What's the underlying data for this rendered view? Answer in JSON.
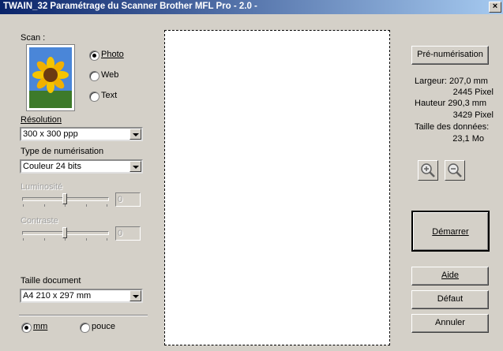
{
  "window": {
    "title": "TWAIN_32 Paramétrage du Scanner Brother MFL Pro - 2.0 -",
    "close_glyph": "×"
  },
  "scan": {
    "label": "Scan :",
    "options": [
      {
        "label": "Photo",
        "selected": true
      },
      {
        "label": "Web",
        "selected": false
      },
      {
        "label": "Text",
        "selected": false
      }
    ]
  },
  "resolution": {
    "label": "Résolution",
    "value": "300 x 300 ppp"
  },
  "scan_type": {
    "label": "Type de numérisation",
    "value": "Couleur 24 bits"
  },
  "brightness": {
    "label": "Luminosité",
    "value": "0",
    "enabled": false
  },
  "contrast": {
    "label": "Contraste",
    "value": "0",
    "enabled": false
  },
  "document_size": {
    "label": "Taille document",
    "value": "A4 210 x 297 mm"
  },
  "units": {
    "options": [
      {
        "label": "mm",
        "selected": true
      },
      {
        "label": "pouce",
        "selected": false
      }
    ]
  },
  "right": {
    "prescan_label": "Pré-numérisation",
    "width_label": "Largeur: 207,0 mm",
    "width_pixels": "2445 Pixel",
    "height_label": "Hauteur 290,3 mm",
    "height_pixels": "3429 Pixel",
    "data_size_label": "Taille des données:",
    "data_size_value": "23,1 Mo",
    "start_label": "Démarrer",
    "help_label": "Aide",
    "default_label": "Défaut",
    "cancel_label": "Annuler"
  },
  "icons": {
    "zoom_in": "zoom-in-icon",
    "zoom_out": "zoom-out-icon",
    "preview": "sunflower-image"
  }
}
